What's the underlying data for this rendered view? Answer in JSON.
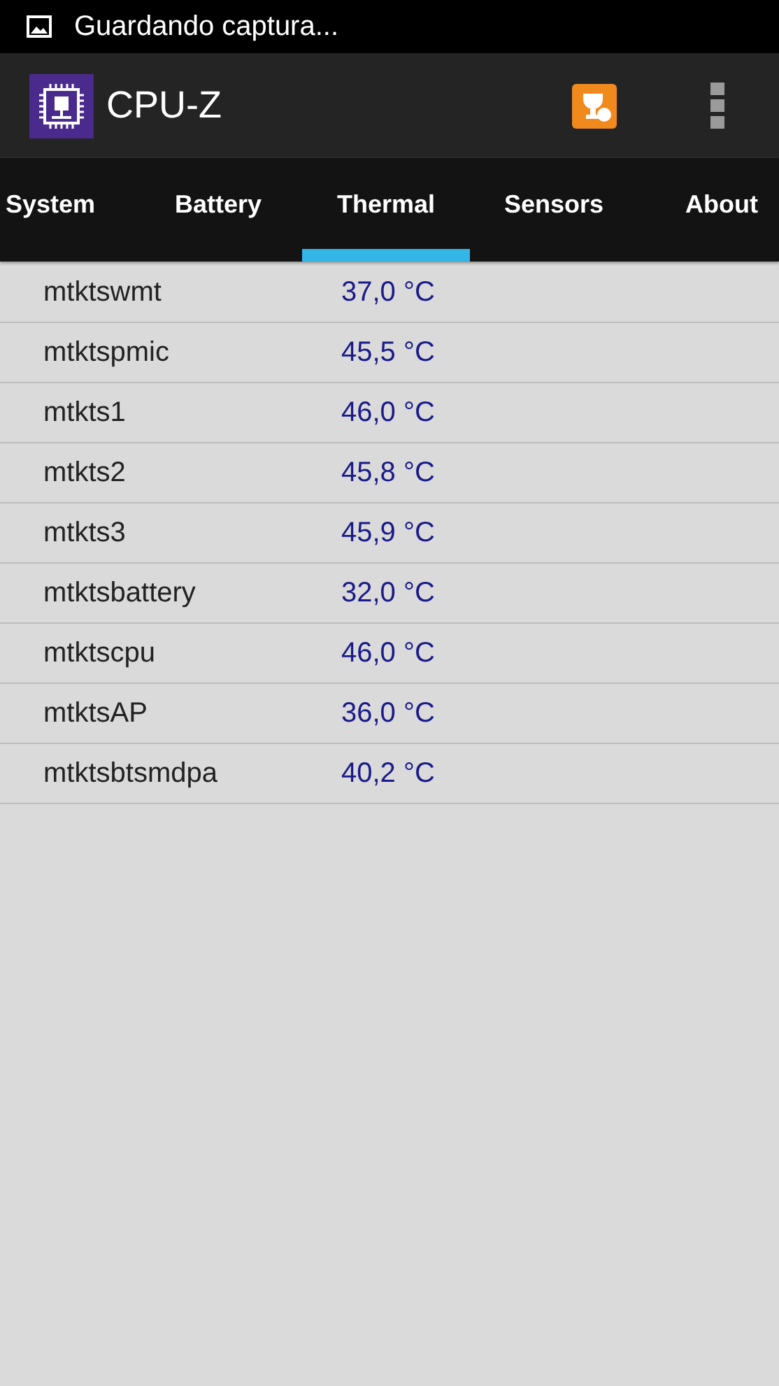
{
  "status_bar": {
    "notification": "Guardando captura..."
  },
  "app_bar": {
    "title": "CPU-Z"
  },
  "tabs": [
    {
      "label": "System",
      "selected": false
    },
    {
      "label": "Battery",
      "selected": false
    },
    {
      "label": "Thermal",
      "selected": true
    },
    {
      "label": "Sensors",
      "selected": false
    },
    {
      "label": "About",
      "selected": false
    }
  ],
  "sensors": [
    {
      "name": "mtktswmt",
      "value": "37,0 °C"
    },
    {
      "name": "mtktspmic",
      "value": "45,5 °C"
    },
    {
      "name": "mtkts1",
      "value": "46,0 °C"
    },
    {
      "name": "mtkts2",
      "value": "45,8 °C"
    },
    {
      "name": "mtkts3",
      "value": "45,9 °C"
    },
    {
      "name": "mtktsbattery",
      "value": "32,0 °C"
    },
    {
      "name": "mtktscpu",
      "value": "46,0 °C"
    },
    {
      "name": "mtktsAP",
      "value": "36,0 °C"
    },
    {
      "name": "mtktsbtsmdpa",
      "value": "40,2 °C"
    }
  ]
}
